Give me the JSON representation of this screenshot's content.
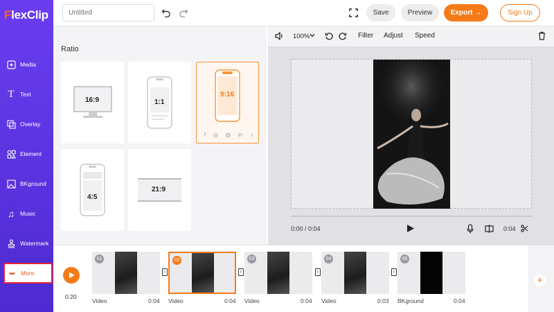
{
  "app": {
    "logo_prefix": "F",
    "logo_suffix": "lexClip"
  },
  "sidebar": {
    "items": [
      {
        "label": "Media",
        "icon": "media-icon"
      },
      {
        "label": "Text",
        "icon": "text-icon"
      },
      {
        "label": "Overlay",
        "icon": "overlay-icon"
      },
      {
        "label": "Element",
        "icon": "element-icon"
      },
      {
        "label": "BKground",
        "icon": "background-icon"
      },
      {
        "label": "Music",
        "icon": "music-icon"
      },
      {
        "label": "Watermark",
        "icon": "watermark-icon"
      },
      {
        "label": "More",
        "icon": "more-dots-icon",
        "dots": "•••"
      }
    ]
  },
  "topbar": {
    "title_placeholder": "Untitled",
    "save_label": "Save",
    "preview_label": "Preview",
    "export_label": "Export →",
    "signup_label": "Sign Up"
  },
  "ratio_panel": {
    "title": "Ratio",
    "options": [
      {
        "label": "16:9",
        "selected": false
      },
      {
        "label": "1:1",
        "selected": false
      },
      {
        "label": "9:16",
        "selected": true
      },
      {
        "label": "4:5",
        "selected": false
      },
      {
        "label": "21:9",
        "selected": false
      }
    ],
    "social_icons": [
      "f",
      "◎",
      "◍",
      "in",
      "♪"
    ]
  },
  "preview_tools": {
    "zoom": "100%",
    "filter_label": "Filter",
    "adjust_label": "Adjust",
    "speed_label": "Speed"
  },
  "player": {
    "current_time": "0:00 / 0:04",
    "right_time": "0:04"
  },
  "timeline": {
    "total_time": "0:20",
    "clips": [
      {
        "num": "01",
        "name": "Video",
        "duration": "0:04",
        "selected": false
      },
      {
        "num": "02",
        "name": "Video",
        "duration": "0:04",
        "selected": true
      },
      {
        "num": "03",
        "name": "Video",
        "duration": "0:04",
        "selected": false
      },
      {
        "num": "04",
        "name": "Video",
        "duration": "0:03",
        "selected": false
      },
      {
        "num": "05",
        "name": "BKground",
        "duration": "0:04",
        "selected": false
      }
    ]
  },
  "colors": {
    "accent": "#f57b19",
    "sidebar": "#5a33e0",
    "highlight": "#e2223b"
  }
}
